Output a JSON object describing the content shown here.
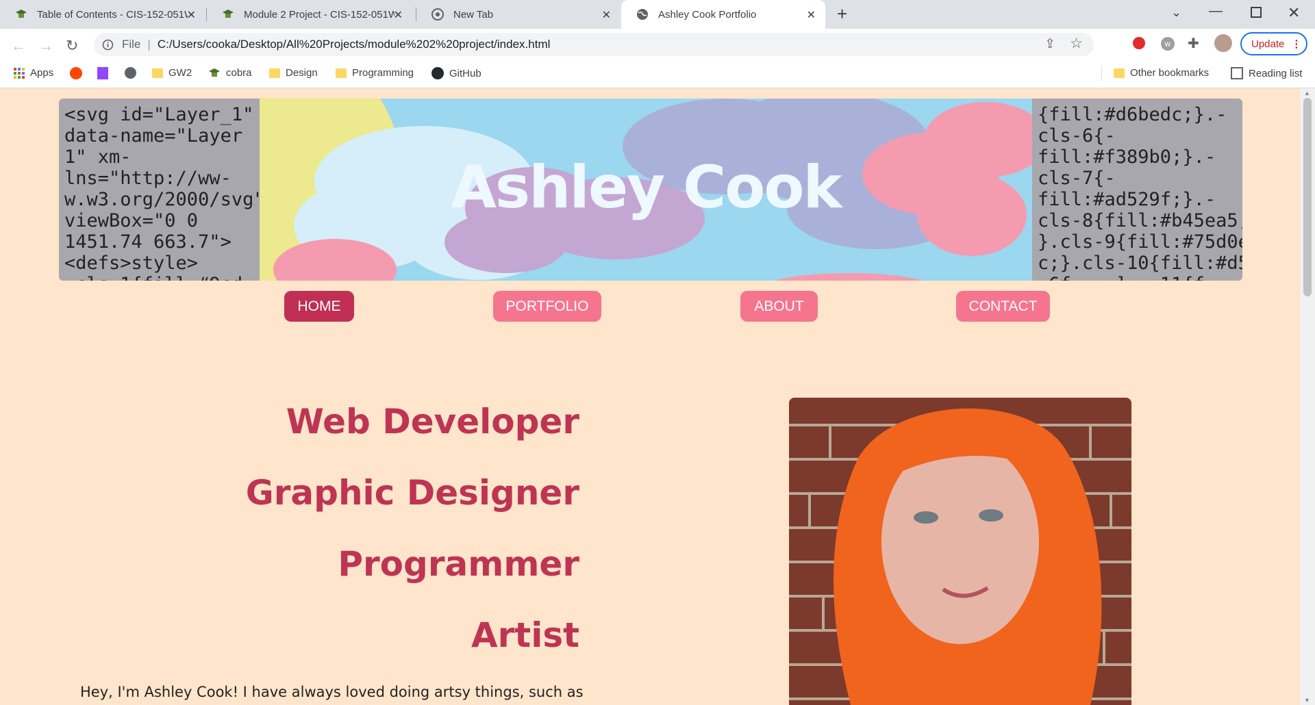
{
  "browser": {
    "tabs": [
      {
        "title": "Table of Contents - CIS-152-051W",
        "icon": "graduation-cap-icon",
        "active": false
      },
      {
        "title": "Module 2 Project - CIS-152-051W",
        "icon": "graduation-cap-icon",
        "active": false
      },
      {
        "title": "New Tab",
        "icon": "chrome-icon",
        "active": false
      },
      {
        "title": "Ashley Cook Portfolio",
        "icon": "globe-icon",
        "active": true
      }
    ],
    "new_tab": "+",
    "address": {
      "scheme_label": "File",
      "url": "C:/Users/cooka/Desktop/All%20Projects/module%202%20project/index.html"
    },
    "update_label": "Update",
    "bookmarks": [
      {
        "label": "Apps",
        "icon": "apps-grid-icon"
      },
      {
        "label": "",
        "icon": "reddit-icon"
      },
      {
        "label": "",
        "icon": "twitch-icon"
      },
      {
        "label": "",
        "icon": "globe-icon"
      },
      {
        "label": "GW2",
        "icon": "folder-icon"
      },
      {
        "label": "cobra",
        "icon": "graduation-cap-icon"
      },
      {
        "label": "Design",
        "icon": "folder-icon"
      },
      {
        "label": "Programming",
        "icon": "folder-icon"
      },
      {
        "label": "GitHub",
        "icon": "github-icon"
      }
    ],
    "other_bookmarks": "Other bookmarks",
    "reading_list": "Reading list"
  },
  "banner": {
    "code_left": "<svg id=\"Layer_1\"\ndata-name=\"Layer\n1\" xm-\nlns=\"http://ww-\nw.w3.org/2000/svg\"\nviewBox=\"0 0\n1451.74 663.7\">\n<defs>style>\n.cls-1{fill:#9cd",
    "code_right": "{fill:#d6bedc;}.-\ncls-6{-\nfill:#f389b0;}.-\ncls-7{-\nfill:#ad529f;}.-\ncls-8{fill:#b45ea5;\n}.cls-9{fill:#75d0e\nc;}.cls-10{fill:#d5\n-6f...-] - 11{f:",
    "name": "Ashley Cook"
  },
  "nav": [
    "HOME",
    "PORTFOLIO",
    "ABOUT",
    "CONTACT"
  ],
  "roles": [
    "Web Developer",
    "Graphic Designer",
    "Programmer",
    "Artist"
  ],
  "bio": "Hey, I'm Ashley Cook! I have always loved doing artsy things, such as",
  "colors": {
    "page_bg": "#fee5cb",
    "accent": "#be3453",
    "nav": "#f5758f",
    "nav_active": "#c12f55"
  }
}
